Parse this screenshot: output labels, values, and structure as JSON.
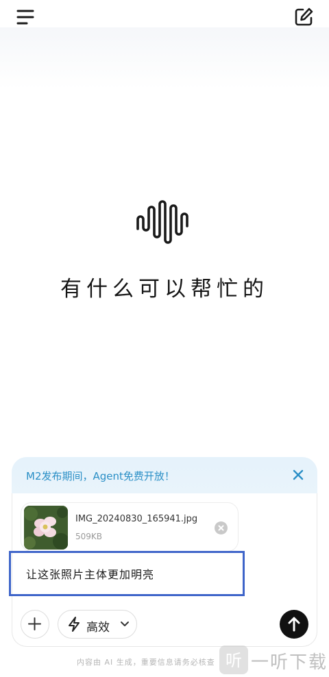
{
  "icons": {
    "menu": "menu-icon",
    "new_chat": "edit-icon",
    "logo": "waveform-logo-icon",
    "close": "close-icon",
    "remove": "remove-attachment-icon",
    "plus": "plus-icon",
    "bolt": "lightning-icon",
    "chevron": "chevron-down-icon",
    "send": "arrow-up-icon"
  },
  "main": {
    "headline": "有什么可以帮忙的"
  },
  "promo": {
    "text": "M2发布期间，Agent免费开放！"
  },
  "attachment": {
    "file_name": "IMG_20240830_165941.jpg",
    "file_size": "509KB"
  },
  "composer": {
    "prompt_text": "让这张照片主体更加明亮",
    "mode_label": "高效"
  },
  "footer": {
    "disclaimer": "内容由 AI 生成，重要信息请务必核查",
    "watermark": "一听下载"
  },
  "colors": {
    "accent": "#2a8fc6",
    "highlight_box": "#3e64c9",
    "send_button": "#111111"
  }
}
